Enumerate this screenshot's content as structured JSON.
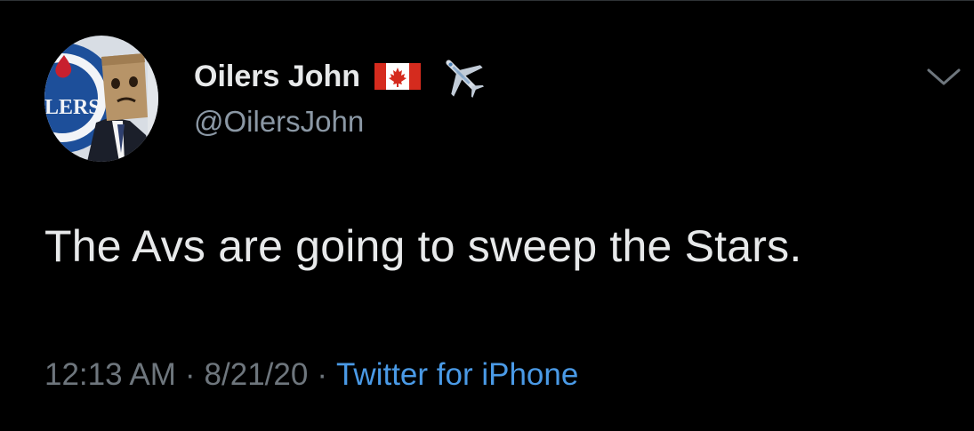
{
  "tweet": {
    "display_name": "Oilers John",
    "handle": "@OilersJohn",
    "text": "The Avs are going to sweep the Stars.",
    "time": "12:13 AM",
    "separator": "·",
    "date": "8/21/20",
    "source": "Twitter for iPhone",
    "name_emojis": [
      "canada-flag-icon",
      "airplane-icon"
    ]
  },
  "colors": {
    "background": "#000000",
    "primary_text": "#e7e9ea",
    "secondary_text": "#8b98a5",
    "link": "#4a9ae6"
  }
}
